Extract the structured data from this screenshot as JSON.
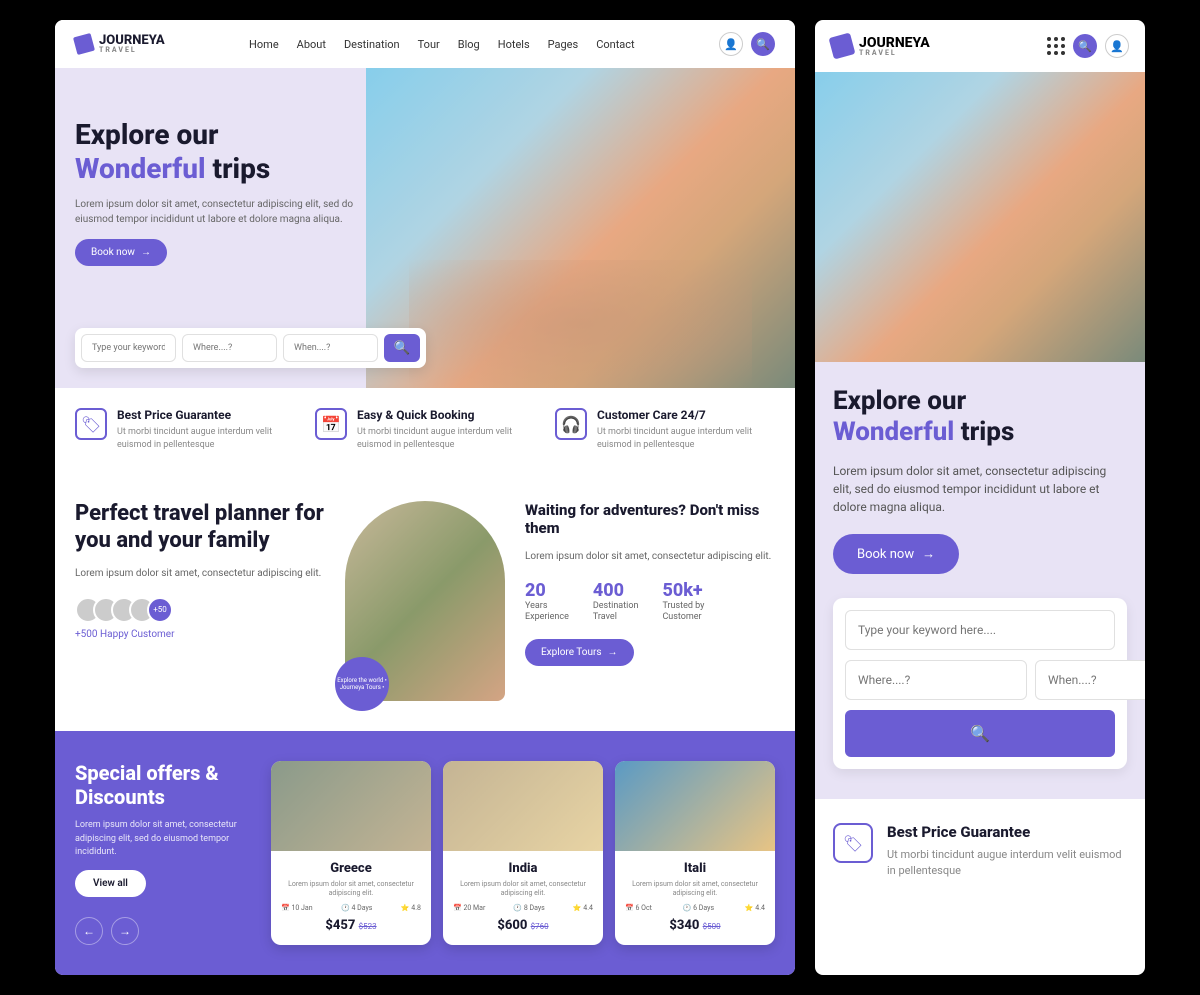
{
  "brand": {
    "name": "JOURNEYA",
    "sub": "TRAVEL"
  },
  "nav": [
    "Home",
    "About",
    "Destination",
    "Tour",
    "Blog",
    "Hotels",
    "Pages",
    "Contact"
  ],
  "hero": {
    "title1": "Explore our",
    "title2a": "Wonderful",
    "title2b": "trips",
    "desc": "Lorem ipsum dolor sit amet, consectetur adipiscing elit, sed do eiusmod tempor incididunt ut labore et dolore magna aliqua.",
    "cta": "Book now"
  },
  "search": {
    "keyword": "Type your keyword here....",
    "where": "Where....?",
    "when": "When....?"
  },
  "features": [
    {
      "title": "Best Price Guarantee",
      "desc": "Ut morbi tincidunt augue interdum velit euismod in pellentesque"
    },
    {
      "title": "Easy & Quick Booking",
      "desc": "Ut morbi tincidunt augue interdum velit euismod in pellentesque"
    },
    {
      "title": "Customer Care 24/7",
      "desc": "Ut morbi tincidunt augue interdum velit euismod in pellentesque"
    }
  ],
  "planner": {
    "title": "Perfect travel planner for you and your family",
    "desc": "Lorem ipsum dolor sit amet, consectetur adipiscing elit.",
    "avatarMore": "+50",
    "happy": "+500 Happy Customer",
    "badge": "Explore the world • Journeya Tours •",
    "waiting": "Waiting for adventures? Don't miss them",
    "waitingDesc": "Lorem ipsum dolor sit amet, consectetur adipiscing elit.",
    "stats": [
      {
        "num": "20",
        "label1": "Years",
        "label2": "Experience"
      },
      {
        "num": "400",
        "label1": "Destination",
        "label2": "Travel"
      },
      {
        "num": "50k+",
        "label1": "Trusted by",
        "label2": "Customer"
      }
    ],
    "exploreBtn": "Explore Tours"
  },
  "offers": {
    "title": "Special offers & Discounts",
    "desc": "Lorem ipsum dolor sit amet, consectetur adipiscing elit, sed do eiusmod tempor incididunt.",
    "viewAll": "View all",
    "cards": [
      {
        "title": "Greece",
        "desc": "Lorem ipsum dolor sit amet, consectetur adipiscing elit.",
        "date": "10 Jan",
        "days": "4 Days",
        "rating": "4.8",
        "price": "$457",
        "old": "$523"
      },
      {
        "title": "India",
        "desc": "Lorem ipsum dolor sit amet, consectetur adipiscing elit.",
        "date": "20 Mar",
        "days": "8 Days",
        "rating": "4.4",
        "price": "$600",
        "old": "$760"
      },
      {
        "title": "Itali",
        "desc": "Lorem ipsum dolor sit amet, consectetur adipiscing elit.",
        "date": "6 Oct",
        "days": "6 Days",
        "rating": "4.4",
        "price": "$340",
        "old": "$500"
      }
    ]
  }
}
